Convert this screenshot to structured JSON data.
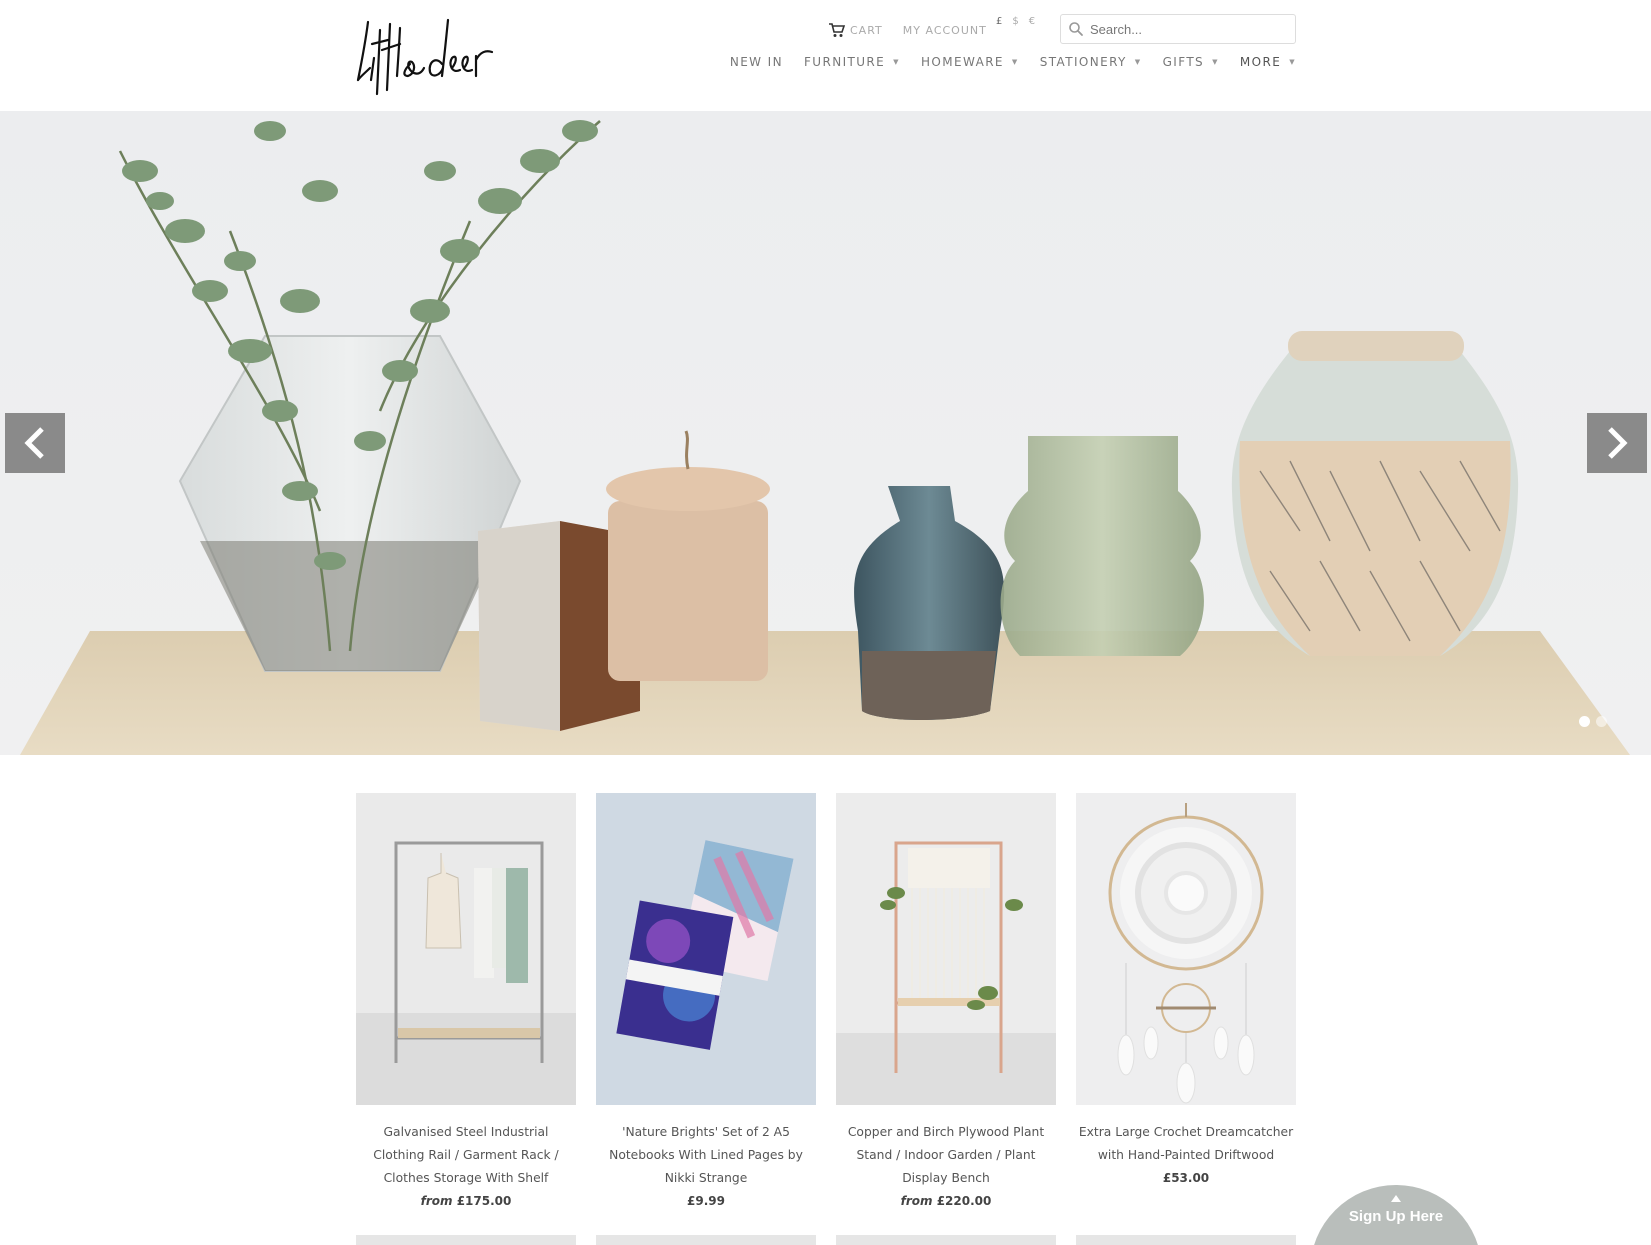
{
  "brand": {
    "logo_text": "little deer"
  },
  "utility": {
    "cart_label": "CART",
    "account_label": "MY ACCOUNT",
    "currencies": [
      "£",
      "$",
      "€"
    ]
  },
  "search": {
    "placeholder": "Search..."
  },
  "nav": {
    "items": [
      {
        "label": "NEW IN",
        "has_dropdown": false
      },
      {
        "label": "FURNITURE",
        "has_dropdown": true
      },
      {
        "label": "HOMEWARE",
        "has_dropdown": true
      },
      {
        "label": "STATIONERY",
        "has_dropdown": true
      },
      {
        "label": "GIFTS",
        "has_dropdown": true
      },
      {
        "label": "MORE",
        "has_dropdown": true
      }
    ],
    "caret": "▼"
  },
  "hero": {
    "slide_count": 2,
    "active_slide": 1
  },
  "products": [
    {
      "title": "Galvanised Steel Industrial Clothing Rail / Garment Rack / Clothes Storage With Shelf",
      "price_prefix": "from",
      "price": "£175.00"
    },
    {
      "title": "'Nature Brights' Set of 2 A5 Notebooks With Lined Pages by Nikki Strange",
      "price_prefix": "",
      "price": "£9.99"
    },
    {
      "title": "Copper and Birch Plywood Plant Stand / Indoor Garden / Plant Display Bench",
      "price_prefix": "from",
      "price": "£220.00"
    },
    {
      "title": "Extra Large Crochet Dreamcatcher with Hand-Painted Driftwood",
      "price_prefix": "",
      "price": "£53.00"
    }
  ],
  "signup": {
    "label": "Sign Up Here"
  },
  "icons": {
    "cart": "cart-icon",
    "search": "search-icon",
    "prev": "chevron-left-icon",
    "next": "chevron-right-icon",
    "signup": "chevron-up-icon"
  },
  "colors": {
    "accent": "#777777",
    "arrow_bg": "#787878",
    "signup_bg": "#b9bebb"
  }
}
